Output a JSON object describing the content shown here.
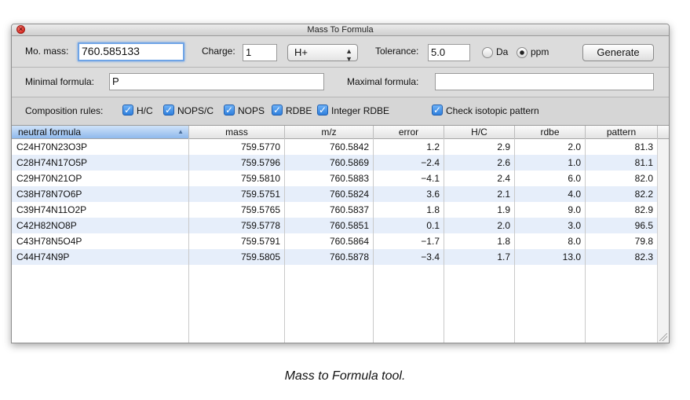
{
  "window": {
    "title": "Mass To Formula"
  },
  "controls": {
    "mono_mass_label": "Mo. mass:",
    "mono_mass_value": "760.585133",
    "charge_label": "Charge:",
    "charge_value": "1",
    "adduct_value": "H+",
    "tolerance_label": "Tolerance:",
    "tolerance_value": "5.0",
    "unit_da_label": "Da",
    "unit_ppm_label": "ppm",
    "unit_selected": "ppm",
    "generate_label": "Generate",
    "minimal_formula_label": "Minimal formula:",
    "minimal_formula_value": "P",
    "maximal_formula_label": "Maximal formula:",
    "maximal_formula_value": ""
  },
  "rules": {
    "label": "Composition rules:",
    "items": [
      {
        "label": "H/C",
        "checked": true
      },
      {
        "label": "NOPS/C",
        "checked": true
      },
      {
        "label": "NOPS",
        "checked": true
      },
      {
        "label": "RDBE",
        "checked": true
      },
      {
        "label": "Integer RDBE",
        "checked": true
      },
      {
        "label": "Check isotopic pattern",
        "checked": true
      }
    ]
  },
  "table": {
    "columns": [
      "neutral formula",
      "mass",
      "m/z",
      "error",
      "H/C",
      "rdbe",
      "pattern"
    ],
    "rows": [
      [
        "C24H70N23O3P",
        "759.5770",
        "760.5842",
        "1.2",
        "2.9",
        "2.0",
        "81.3"
      ],
      [
        "C28H74N17O5P",
        "759.5796",
        "760.5869",
        "−2.4",
        "2.6",
        "1.0",
        "81.1"
      ],
      [
        "C29H70N21OP",
        "759.5810",
        "760.5883",
        "−4.1",
        "2.4",
        "6.0",
        "82.0"
      ],
      [
        "C38H78N7O6P",
        "759.5751",
        "760.5824",
        "3.6",
        "2.1",
        "4.0",
        "82.2"
      ],
      [
        "C39H74N11O2P",
        "759.5765",
        "760.5837",
        "1.8",
        "1.9",
        "9.0",
        "82.9"
      ],
      [
        "C42H82NO8P",
        "759.5778",
        "760.5851",
        "0.1",
        "2.0",
        "3.0",
        "96.5"
      ],
      [
        "C43H78N5O4P",
        "759.5791",
        "760.5864",
        "−1.7",
        "1.8",
        "8.0",
        "79.8"
      ],
      [
        "C44H74N9P",
        "759.5805",
        "760.5878",
        "−3.4",
        "1.7",
        "13.0",
        "82.3"
      ]
    ]
  },
  "caption": "Mass to Formula tool.",
  "colors": {
    "selected_header": "#8fb9ec",
    "row_alt": "#e6eefa",
    "checkbox": "#2f7fdc"
  }
}
